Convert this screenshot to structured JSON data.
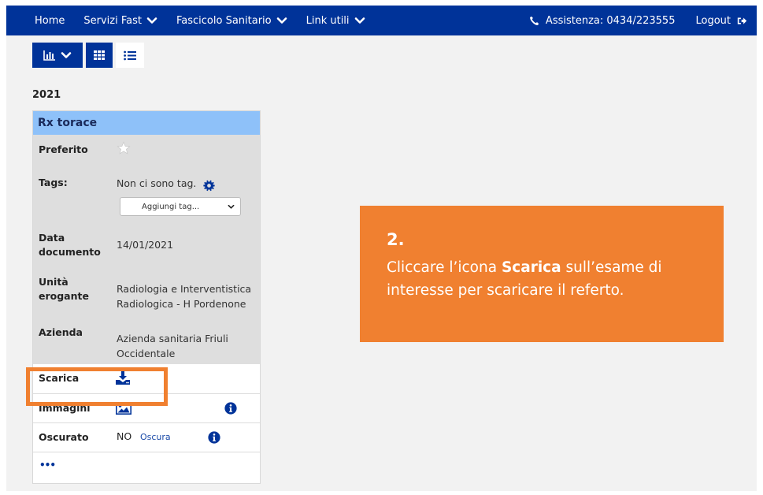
{
  "navbar": {
    "home": "Home",
    "servizi": "Servizi Fast",
    "fascicolo": "Fascicolo Sanitario",
    "link_utili": "Link utili",
    "assistenza": "Assistenza: 0434/223555",
    "logout": "Logout"
  },
  "year": "2021",
  "card": {
    "title": "Rx torace",
    "preferito_label": "Preferito",
    "tags_label": "Tags:",
    "tags_value": "Non ci sono tag.",
    "tag_select_placeholder": "Aggiungi tag...",
    "data_label_1": "Data",
    "data_label_2": "documento",
    "data_value": "14/01/2021",
    "unita_label_1": "Unità",
    "unita_label_2": "erogante",
    "unita_value_1": "Radiologia e Interventistica",
    "unita_value_2": "Radiologica - H Pordenone",
    "azienda_label": "Azienda",
    "azienda_value_1": "Azienda sanitaria Friuli",
    "azienda_value_2": "Occidentale",
    "scarica_label": "Scarica",
    "immagini_label": "Immagini",
    "oscurato_label": "Oscurato",
    "oscurato_value": "NO",
    "oscura_link": "Oscura",
    "more": "•••"
  },
  "callout": {
    "number": "2.",
    "text_before": "Cliccare l’icona ",
    "text_bold": "Scarica",
    "text_after": " sull’esame di interesse per scaricare il referto."
  },
  "colors": {
    "navbar": "#003399",
    "card_header": "#8ec1f9",
    "highlight": "#f08030"
  }
}
